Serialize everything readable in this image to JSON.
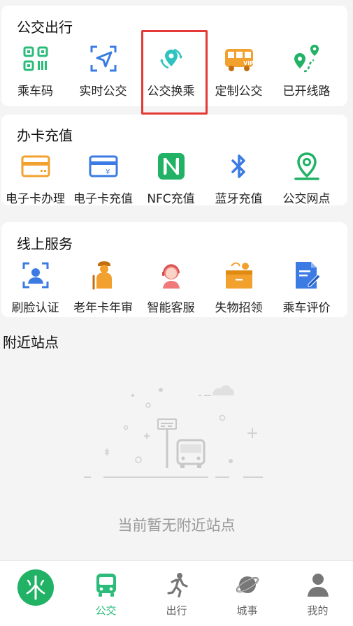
{
  "sections": [
    {
      "title": "公交出行",
      "items": [
        {
          "label": "乘车码",
          "icon": "qr-code-icon"
        },
        {
          "label": "实时公交",
          "icon": "navigation-arrow-icon"
        },
        {
          "label": "公交换乘",
          "icon": "transfer-location-icon"
        },
        {
          "label": "定制公交",
          "icon": "vip-bus-icon"
        },
        {
          "label": "已开线路",
          "icon": "route-pins-icon"
        }
      ]
    },
    {
      "title": "办卡充值",
      "items": [
        {
          "label": "电子卡办理",
          "icon": "card-icon"
        },
        {
          "label": "电子卡充值",
          "icon": "card-recharge-icon"
        },
        {
          "label": "NFC充值",
          "icon": "nfc-icon"
        },
        {
          "label": "蓝牙充值",
          "icon": "bluetooth-icon"
        },
        {
          "label": "公交网点",
          "icon": "location-pin-icon"
        }
      ]
    },
    {
      "title": "线上服务",
      "items": [
        {
          "label": "刷脸认证",
          "icon": "face-scan-icon"
        },
        {
          "label": "老年卡年审",
          "icon": "elderly-icon"
        },
        {
          "label": "智能客服",
          "icon": "customer-service-icon"
        },
        {
          "label": "失物招领",
          "icon": "lost-found-box-icon"
        },
        {
          "label": "乘车评价",
          "icon": "review-document-icon"
        }
      ]
    }
  ],
  "nearby": {
    "title": "附近站点",
    "empty_text": "当前暂无附近站点"
  },
  "tabs": [
    {
      "label": "",
      "icon": "app-logo-icon"
    },
    {
      "label": "公交",
      "icon": "bus-icon",
      "active": true
    },
    {
      "label": "出行",
      "icon": "walking-icon"
    },
    {
      "label": "城事",
      "icon": "planet-icon"
    },
    {
      "label": "我的",
      "icon": "user-icon"
    }
  ],
  "colors": {
    "accent_green": "#2bbc7a",
    "blue": "#3b7be3",
    "orange": "#f2a02e",
    "highlight_red": "#e53935"
  }
}
